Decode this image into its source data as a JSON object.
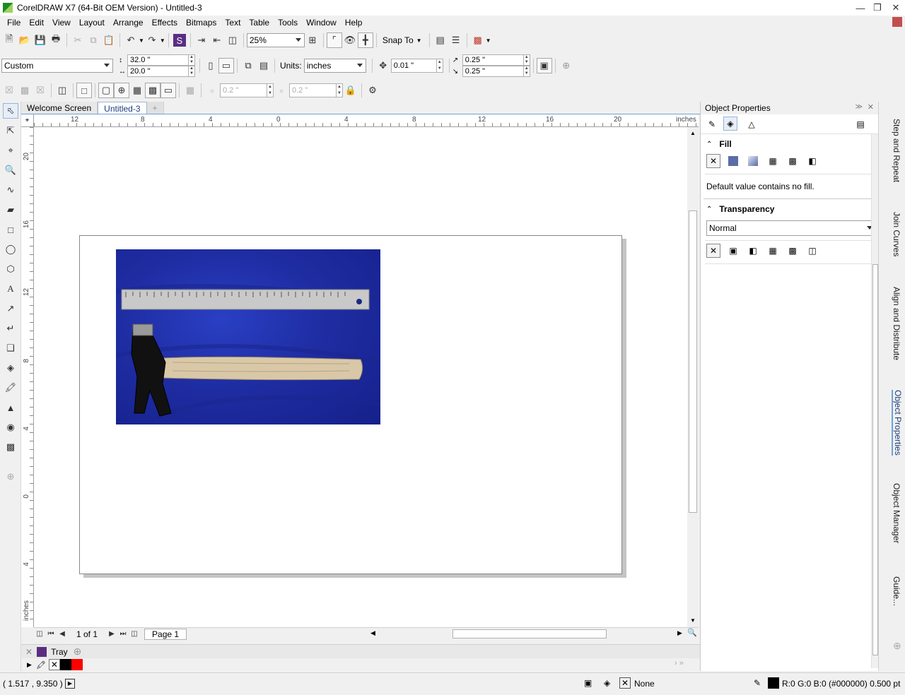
{
  "app": {
    "title": "CorelDRAW X7 (64-Bit OEM Version) - Untitled-3"
  },
  "menu": [
    "File",
    "Edit",
    "View",
    "Layout",
    "Arrange",
    "Effects",
    "Bitmaps",
    "Text",
    "Table",
    "Tools",
    "Window",
    "Help"
  ],
  "standard_toolbar": {
    "zoom": "25%",
    "snap_to": "Snap To"
  },
  "property_bar": {
    "page_preset": "Custom",
    "page_width": "32.0 \"",
    "page_height": "20.0 \"",
    "units_label": "Units:",
    "units": "inches",
    "nudge": "0.01 \"",
    "dup_x": "0.25 \"",
    "dup_y": "0.25 \""
  },
  "secondary_bar": {
    "value_a": "0.2 \"",
    "value_b": "0.2 \""
  },
  "doc_tabs": [
    "Welcome Screen",
    "Untitled-3"
  ],
  "ruler": {
    "h_labels": [
      "12",
      "8",
      "4",
      "0",
      "4",
      "8",
      "12",
      "16",
      "20"
    ],
    "h_unit": "inches",
    "v_labels": [
      "20",
      "16",
      "12",
      "8",
      "4",
      "0",
      "4"
    ],
    "v_unit": "inches"
  },
  "page_nav": {
    "counter": "1 of 1",
    "page_tab": "Page 1"
  },
  "tray": {
    "label": "Tray"
  },
  "status": {
    "coords": "( 1.517 , 9.350 )",
    "fill": "None",
    "outline": "R:0 G:0 B:0 (#000000)  0.500 pt"
  },
  "object_properties": {
    "title": "Object Properties",
    "fill_header": "Fill",
    "fill_message": "Default value contains no fill.",
    "transparency_header": "Transparency",
    "transparency_mode": "Normal"
  },
  "side_tabs": [
    "Step and Repeat",
    "Join Curves",
    "Align and Distribute",
    "Object Properties",
    "Object Manager",
    "Guide..."
  ],
  "colors": {
    "accent": "#1f3f7a",
    "swatch_black": "#000000",
    "swatch_red": "#ff0000"
  }
}
